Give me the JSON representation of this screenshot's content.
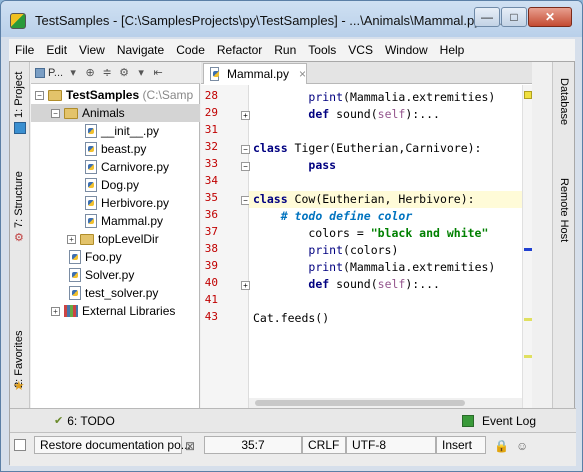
{
  "window": {
    "title": "TestSamples - [C:\\SamplesProjects\\py\\TestSamples] - ...\\Animals\\Mammal.py - ...",
    "minimize": "—",
    "maximize": "□",
    "close": "✕"
  },
  "menu": [
    "File",
    "Edit",
    "View",
    "Navigate",
    "Code",
    "Refactor",
    "Run",
    "Tools",
    "VCS",
    "Window",
    "Help"
  ],
  "left_tabs": {
    "project": "1: Project",
    "structure": "7: Structure",
    "favorites": "2: Favorites"
  },
  "right_tabs": {
    "database": "Database",
    "remote_host": "Remote Host"
  },
  "project_panel": {
    "selector": "P...",
    "tree": [
      {
        "label": "TestSamples",
        "suffix": "(C:\\Samp",
        "type": "folder",
        "bold": true,
        "depth": 0,
        "exp": "−"
      },
      {
        "label": "Animals",
        "type": "folder",
        "depth": 1,
        "exp": "−",
        "selected": true
      },
      {
        "label": "__init__.py",
        "type": "py",
        "depth": 2
      },
      {
        "label": "beast.py",
        "type": "py",
        "depth": 2
      },
      {
        "label": "Carnivore.py",
        "type": "py",
        "depth": 2
      },
      {
        "label": "Dog.py",
        "type": "py",
        "depth": 2
      },
      {
        "label": "Herbivore.py",
        "type": "py",
        "depth": 2
      },
      {
        "label": "Mammal.py",
        "type": "py",
        "depth": 2
      },
      {
        "label": "topLevelDir",
        "type": "folder",
        "depth": 1,
        "exp": "+"
      },
      {
        "label": "Foo.py",
        "type": "py",
        "depth": 1
      },
      {
        "label": "Solver.py",
        "type": "py",
        "depth": 1
      },
      {
        "label": "test_solver.py",
        "type": "py",
        "depth": 1
      },
      {
        "label": "External Libraries",
        "type": "lib",
        "depth": 0,
        "exp": "+"
      }
    ]
  },
  "editor": {
    "tab": "Mammal.py",
    "tab_close": "×",
    "line_numbers": [
      "28",
      "29",
      "31",
      "32",
      "33",
      "34",
      "35",
      "36",
      "37",
      "38",
      "39",
      "40",
      "41",
      "43"
    ],
    "lines": [
      {
        "text": "        print(Mammalia.extremities)"
      },
      {
        "text": "        def sound(self):..."
      },
      {
        "text": ""
      },
      {
        "text": "class Tiger(Eutherian,Carnivore):"
      },
      {
        "text": "        pass"
      },
      {
        "text": ""
      },
      {
        "text": "class Cow(Eutherian, Herbivore):"
      },
      {
        "text": "    # todo define color"
      },
      {
        "text": "        colors = \"black and white\""
      },
      {
        "text": "        print(colors)"
      },
      {
        "text": "        print(Mammalia.extremities)"
      },
      {
        "text": "        def sound(self):..."
      },
      {
        "text": ""
      },
      {
        "text": "Cat.feeds()"
      }
    ]
  },
  "toolwindows": {
    "todo": "6: TODO",
    "event_log": "Event Log"
  },
  "status": {
    "message": "Restore documentation po...",
    "position": "35:7",
    "line_sep": "CRLF",
    "encoding": "UTF-8",
    "mode": "Insert"
  },
  "colors": {
    "keyword": "#000080",
    "string": "#008000",
    "todo": "#0073bf",
    "line_number": "#c00000",
    "caret_line": "#fffbd8"
  }
}
